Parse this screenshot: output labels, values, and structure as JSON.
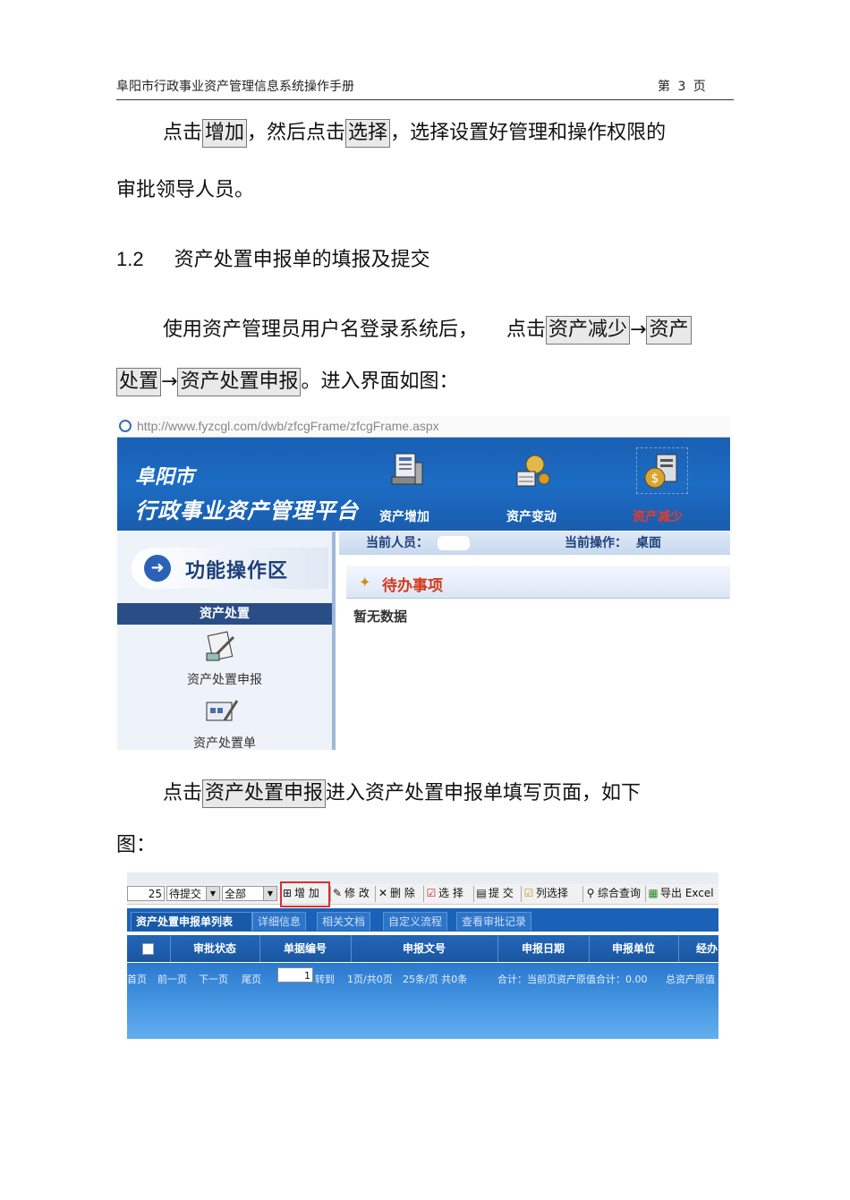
{
  "header": {
    "title": "阜阳市行政事业资产管理信息系统操作手册",
    "page": "第 3 页"
  },
  "para1": {
    "pre": "点击",
    "btn1": "增加",
    "mid": "，然后点击",
    "btn2": "选择",
    "post": "，选择设置好管理和操作权限的",
    "line2": "审批领导人员。"
  },
  "section": {
    "num": "1.2",
    "title": "资产处置申报单的填报及提交"
  },
  "para2": {
    "pre": "使用资产管理员用户名登录系统后，",
    "pre2": "点击",
    "btn1": "资产减少",
    "arrow1": "→",
    "btn2a": "资产",
    "btn2b": "处置",
    "arrow2": "→",
    "btn3": "资产处置申报",
    "post": "。进入界面如图："
  },
  "shot1": {
    "url": "http://www.fyzcgl.com/dwb/zfcgFrame/zfcgFrame.aspx",
    "logo_line1": "阜阳市",
    "logo_line2": "行政事业资产管理平台",
    "nav": [
      {
        "label": "资产增加"
      },
      {
        "label": "资产变动"
      },
      {
        "label": "资产减少",
        "active": true
      }
    ],
    "current_user_label": "当前人员：",
    "current_op_label": "当前操作：",
    "current_op_value": "桌面",
    "func_area": "功能操作区",
    "section": "资产处置",
    "items": [
      "资产处置申报",
      "资产处置单"
    ],
    "todo_title": "待办事项",
    "todo_empty": "暂无数据"
  },
  "para3": {
    "pre": "点击",
    "btn": "资产处置申报",
    "post": "进入资产处置申报单填写页面，如下",
    "line2": "图："
  },
  "shot2": {
    "page_size": "25",
    "status_select": "待提交",
    "scope_select": "全部",
    "buttons": {
      "add": "增 加",
      "edit": "修 改",
      "delete": "删 除",
      "choose": "选 择",
      "submit": "提 交",
      "columns": "列选择",
      "query": "综合查询",
      "export": "导出 Excel"
    },
    "tabs": [
      "资产处置申报单列表",
      "详细信息",
      "相关文档",
      "自定义流程",
      "查看审批记录"
    ],
    "columns": [
      "审批状态",
      "单据编号",
      "申报文号",
      "申报日期",
      "申报单位",
      "经办"
    ],
    "pager": {
      "first": "首页",
      "prev": "前一页",
      "next": "下一页",
      "last": "尾页",
      "page_value": "1",
      "goto": "转到",
      "pages": "1页/共0页",
      "per_page": "25条/页 共0条",
      "summary": "合计：当前页资产原值合计：0.00",
      "summary2": "总资产原值"
    }
  },
  "colors": {
    "banner_blue": "#1c6cc4",
    "active_red": "#e73a2e",
    "highlight_red": "#d6302f"
  }
}
